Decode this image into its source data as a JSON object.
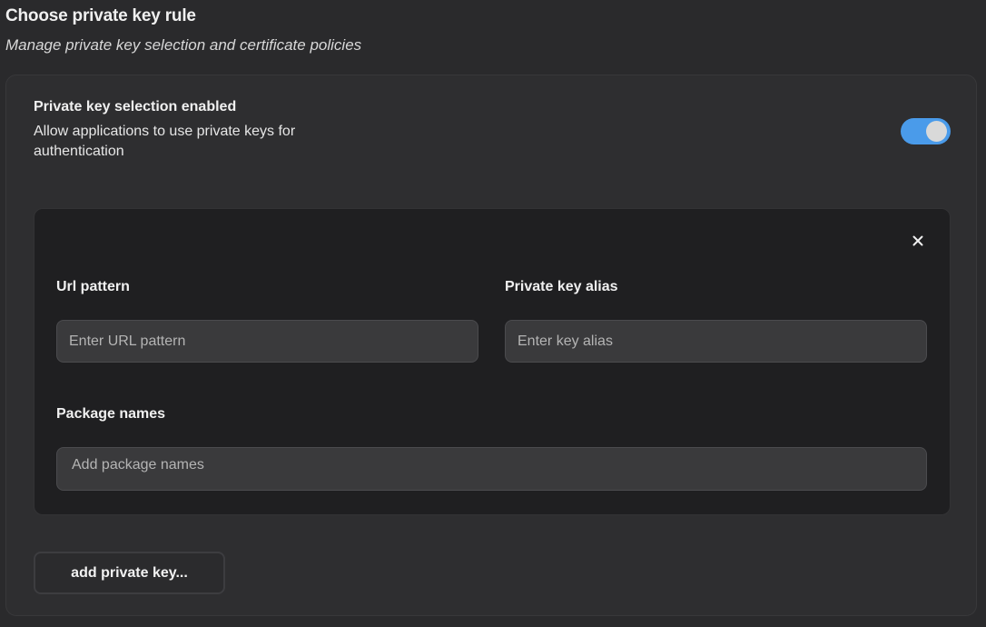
{
  "header": {
    "title": "Choose private key rule",
    "subtitle": "Manage private key selection and certificate policies"
  },
  "setting": {
    "label": "Private key selection enabled",
    "description": "Allow applications to use private keys for authentication",
    "enabled": true
  },
  "rule": {
    "close_icon": "close-icon",
    "url_pattern": {
      "label": "Url pattern",
      "value": "",
      "placeholder": "Enter URL pattern"
    },
    "key_alias": {
      "label": "Private key alias",
      "value": "",
      "placeholder": "Enter key alias"
    },
    "package_names": {
      "label": "Package names",
      "value": "",
      "placeholder": "Add package names"
    }
  },
  "actions": {
    "add_label": "add private key..."
  },
  "colors": {
    "background": "#2a2a2c",
    "card": "#2e2e30",
    "rule_card": "#1f1f21",
    "input": "#3a3a3c",
    "toggle_on": "#4a9bea"
  }
}
